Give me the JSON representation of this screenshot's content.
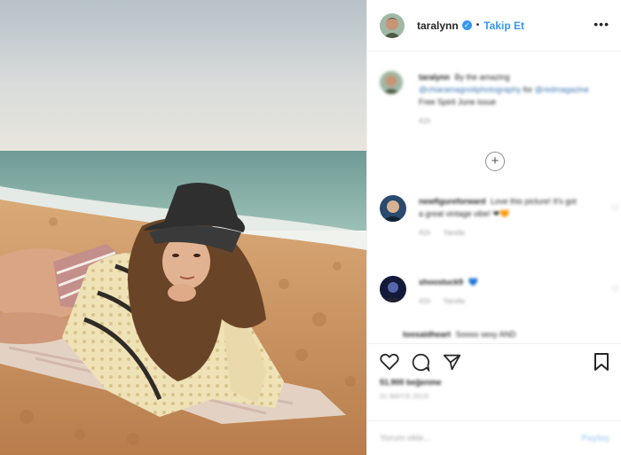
{
  "post": {
    "username": "taralynn",
    "follow_label": "Takip Et",
    "dot": "•",
    "more_icon": "more-options-icon",
    "verified_icon": "verified-badge-icon",
    "photo_alt": "photo"
  },
  "caption": {
    "username": "taralynn",
    "text": "By the amazing",
    "link1": "@chiaramagnoliphotography",
    "text_mid": "for",
    "link2": "@redmagazine",
    "text_end": "Free Spirit June issue",
    "time": "41h"
  },
  "load_more": "+",
  "comments": [
    {
      "username": "newfigureforward",
      "text": "Love this picture! It's got a great vintage vibe!",
      "emoji": "❤🧡",
      "time": "41h",
      "reply": "Yanıtla"
    },
    {
      "username": "shoostuck9",
      "text": "💙",
      "emoji": "",
      "time": "41h",
      "reply": "Yanıtla"
    },
    {
      "username": "toosaidheart",
      "text": "Soooo sexy AND"
    }
  ],
  "actions": {
    "like_icon": "heart-icon",
    "comment_icon": "comment-icon",
    "share_icon": "share-icon",
    "save_icon": "bookmark-icon",
    "likes": "51.900 beğenme",
    "date": "31 MAYIS 2019"
  },
  "comment_box": {
    "placeholder": "Yorum ekle...",
    "post_label": "Paylaş"
  },
  "colors": {
    "accent": "#3897f0",
    "link": "#3a73b2",
    "muted": "#999999",
    "border": "#efefef"
  }
}
